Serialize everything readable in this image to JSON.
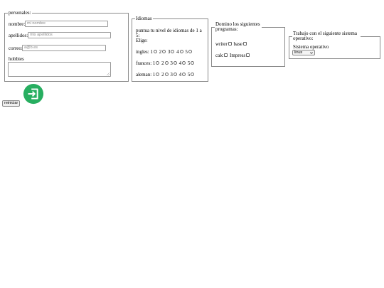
{
  "personales": {
    "legend": "personales:",
    "nombre": {
      "label": "nombre:",
      "placeholder": "mi nombre"
    },
    "apellidos": {
      "label": "apellidos:",
      "placeholder": "mis apellidos"
    },
    "correo": {
      "label": "correo:",
      "placeholder": "a@b.es"
    },
    "hobbies": {
      "label": "hobbies"
    }
  },
  "idiomas": {
    "legend": "Idiomas",
    "instruction": "puntua tu nivel de idiomas de 1 a 5:",
    "elige": "Elige:",
    "rows": [
      {
        "name": "ingles:",
        "options": [
          "1",
          "2",
          "3",
          "4",
          "5"
        ]
      },
      {
        "name": "frances:",
        "options": [
          "1",
          "2",
          "3",
          "4",
          "5"
        ]
      },
      {
        "name": "aleman:",
        "options": [
          "1",
          "2",
          "3",
          "4",
          "5"
        ]
      }
    ]
  },
  "programas": {
    "legend": "Domino los siguientes programas:",
    "items": [
      "writer",
      "base",
      "calc",
      "Impress"
    ]
  },
  "sistema": {
    "legend": "Trabajo con el siguiente sistema operativo:",
    "label": "Sistema operativo",
    "selected": "linux"
  },
  "reiniciar_label": "reiniciar",
  "icon_color": "#27ae60"
}
